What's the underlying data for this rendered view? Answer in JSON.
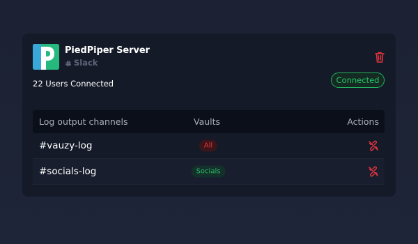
{
  "server": {
    "name": "PiedPiper Server",
    "platform": "Slack",
    "users_connected": "22 Users Connected",
    "status": "Connected"
  },
  "table": {
    "headers": {
      "channel": "Log output channels",
      "vaults": "Vaults",
      "actions": "Actions"
    },
    "rows": [
      {
        "channel": "#vauzy-log",
        "vault": "All",
        "vault_color": "#e4343e"
      },
      {
        "channel": "#socials-log",
        "vault": "Socials",
        "vault_color": "#2ebd6b"
      }
    ]
  },
  "colors": {
    "accent_green": "#27c46a",
    "danger_red": "#e4343e",
    "logo_green": "#26b97e",
    "logo_blue": "#3aa7d9"
  },
  "icons": {
    "logo": "piedpiper-logo-icon",
    "platform": "slack-icon",
    "delete": "trash-icon",
    "unlink": "unlink-icon"
  }
}
